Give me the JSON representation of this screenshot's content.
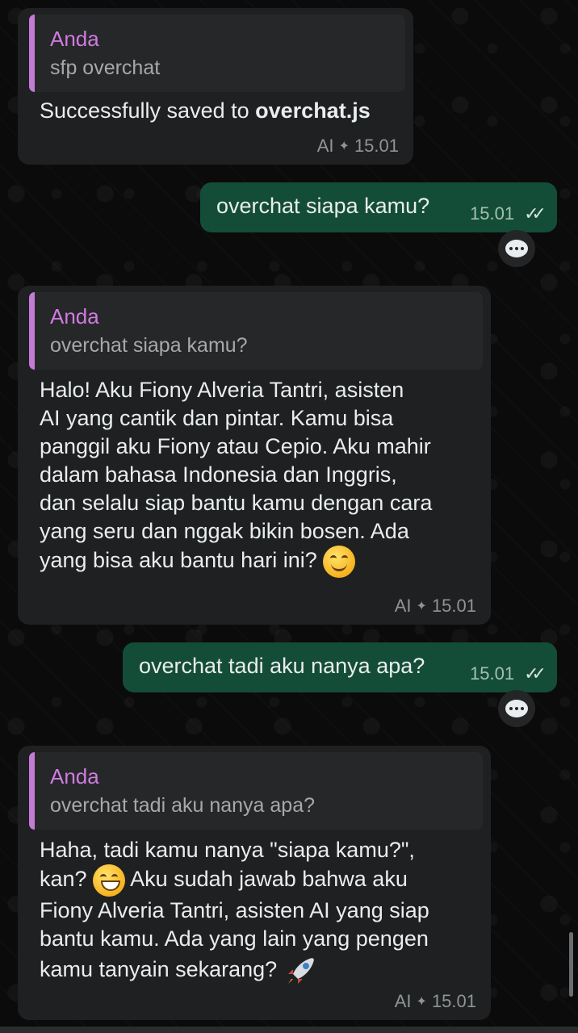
{
  "messages": [
    {
      "quote_author": "Anda",
      "quote_text": "sfp overchat",
      "text_prefix": "Successfully saved to ",
      "text_bold": "overchat.js",
      "tag": "AI",
      "time": "15.01"
    },
    {
      "text": "overchat siapa kamu?",
      "time": "15.01"
    },
    {
      "quote_author": "Anda",
      "quote_text": "overchat siapa kamu?",
      "text": "Halo! Aku Fiony Alveria Tantri, asisten\nAI yang cantik dan pintar. Kamu bisa\npanggil aku Fiony atau Cepio. Aku mahir\ndalam bahasa Indonesia dan Inggris,\ndan selalu siap bantu kamu dengan cara\nyang seru dan nggak bikin bosen. Ada\nyang bisa aku bantu hari ini?",
      "tag": "AI",
      "time": "15.01"
    },
    {
      "text": "overchat tadi aku nanya apa?",
      "time": "15.01"
    },
    {
      "quote_author": "Anda",
      "quote_text": "overchat tadi aku nanya apa?",
      "text_a": "Haha, tadi kamu nanya \"siapa kamu?\",\nkan?",
      "text_b": "Aku sudah jawab bahwa aku",
      "text_c": "Fiony Alveria Tantri, asisten AI yang siap\nbantu kamu. Ada yang lain yang pengen\nkamu tanyain sekarang?",
      "tag": "AI",
      "time": "15.01"
    }
  ],
  "icons": {
    "double_check": "double-check-icon",
    "ai_spark": "ai-sparkle-icon",
    "reply_bubble": "chat-bubble-icon",
    "smile": "smiling-face-emoji",
    "grin": "grinning-face-emoji",
    "rocket": "rocket-emoji"
  },
  "colors": {
    "incoming": "#1f2021",
    "outgoing": "#144d37",
    "quote_accent": "#c37bd6"
  }
}
